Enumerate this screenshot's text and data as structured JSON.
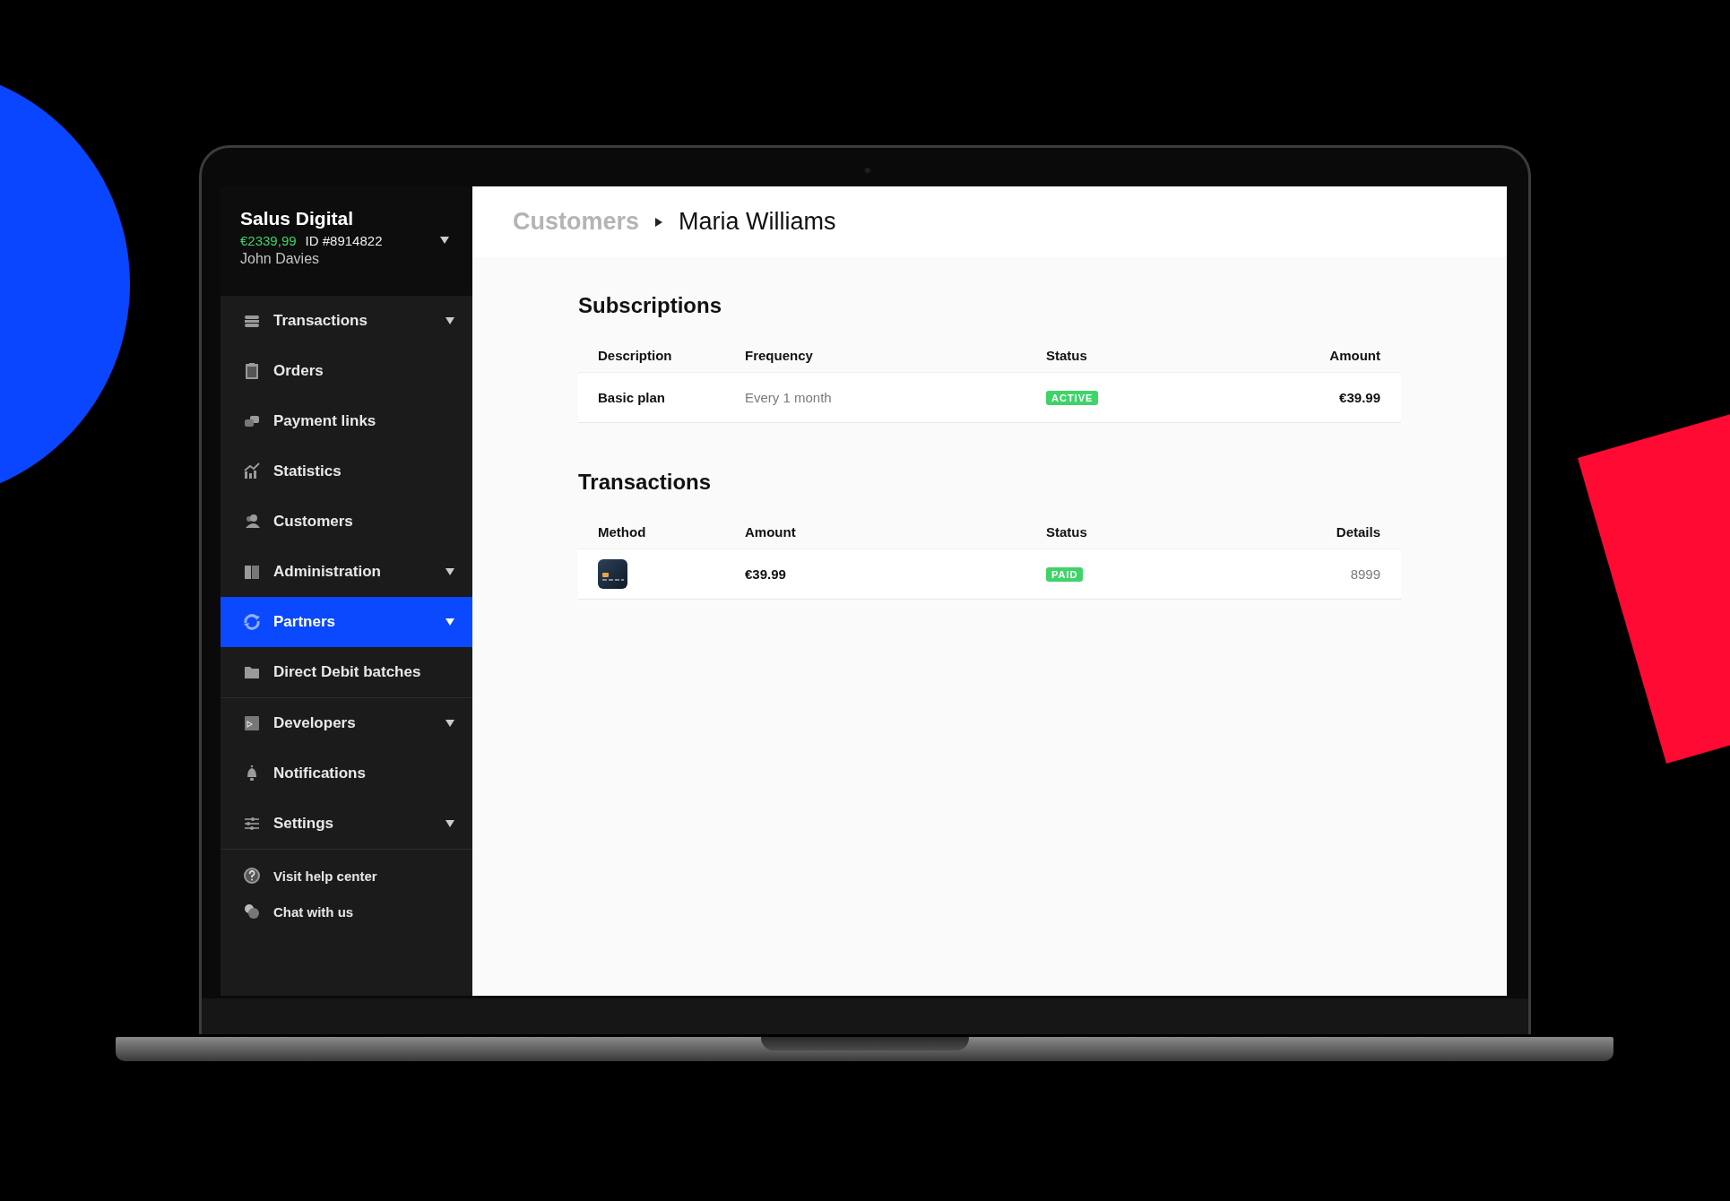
{
  "account": {
    "name": "Salus Digital",
    "balance": "€2339,99",
    "id": "ID #8914822",
    "user": "John Davies"
  },
  "sidebar": {
    "sections": [
      {
        "items": [
          {
            "label": "Transactions",
            "expandable": true,
            "selected": false
          },
          {
            "label": "Orders",
            "expandable": false,
            "selected": false
          },
          {
            "label": "Payment links",
            "expandable": false,
            "selected": false
          },
          {
            "label": "Statistics",
            "expandable": false,
            "selected": false
          },
          {
            "label": "Customers",
            "expandable": false,
            "selected": false
          },
          {
            "label": "Administration",
            "expandable": true,
            "selected": false
          },
          {
            "label": "Partners",
            "expandable": true,
            "selected": true
          },
          {
            "label": "Direct Debit batches",
            "expandable": false,
            "selected": false
          }
        ]
      },
      {
        "items": [
          {
            "label": "Developers",
            "expandable": true,
            "selected": false
          },
          {
            "label": "Notifications",
            "expandable": false,
            "selected": false
          },
          {
            "label": "Settings",
            "expandable": true,
            "selected": false
          }
        ]
      }
    ],
    "footer_links": [
      "Visit help center",
      "Chat with us"
    ]
  },
  "breadcrumb": [
    {
      "label": "Customers",
      "current": false
    },
    {
      "label": "Maria Williams",
      "current": true
    }
  ],
  "subscriptions": {
    "title": "Subscriptions",
    "columns": [
      "Description",
      "Frequency",
      "Status",
      "Amount"
    ],
    "rows": [
      {
        "description": "Basic plan",
        "frequency": "Every 1 month",
        "status": "ACTIVE",
        "amount": "€39.99"
      }
    ]
  },
  "transactions": {
    "title": "Transactions",
    "columns": [
      "Method",
      "Amount",
      "Status",
      "Details"
    ],
    "rows": [
      {
        "amount": "€39.99",
        "status": "PAID",
        "details": "8999"
      }
    ]
  }
}
